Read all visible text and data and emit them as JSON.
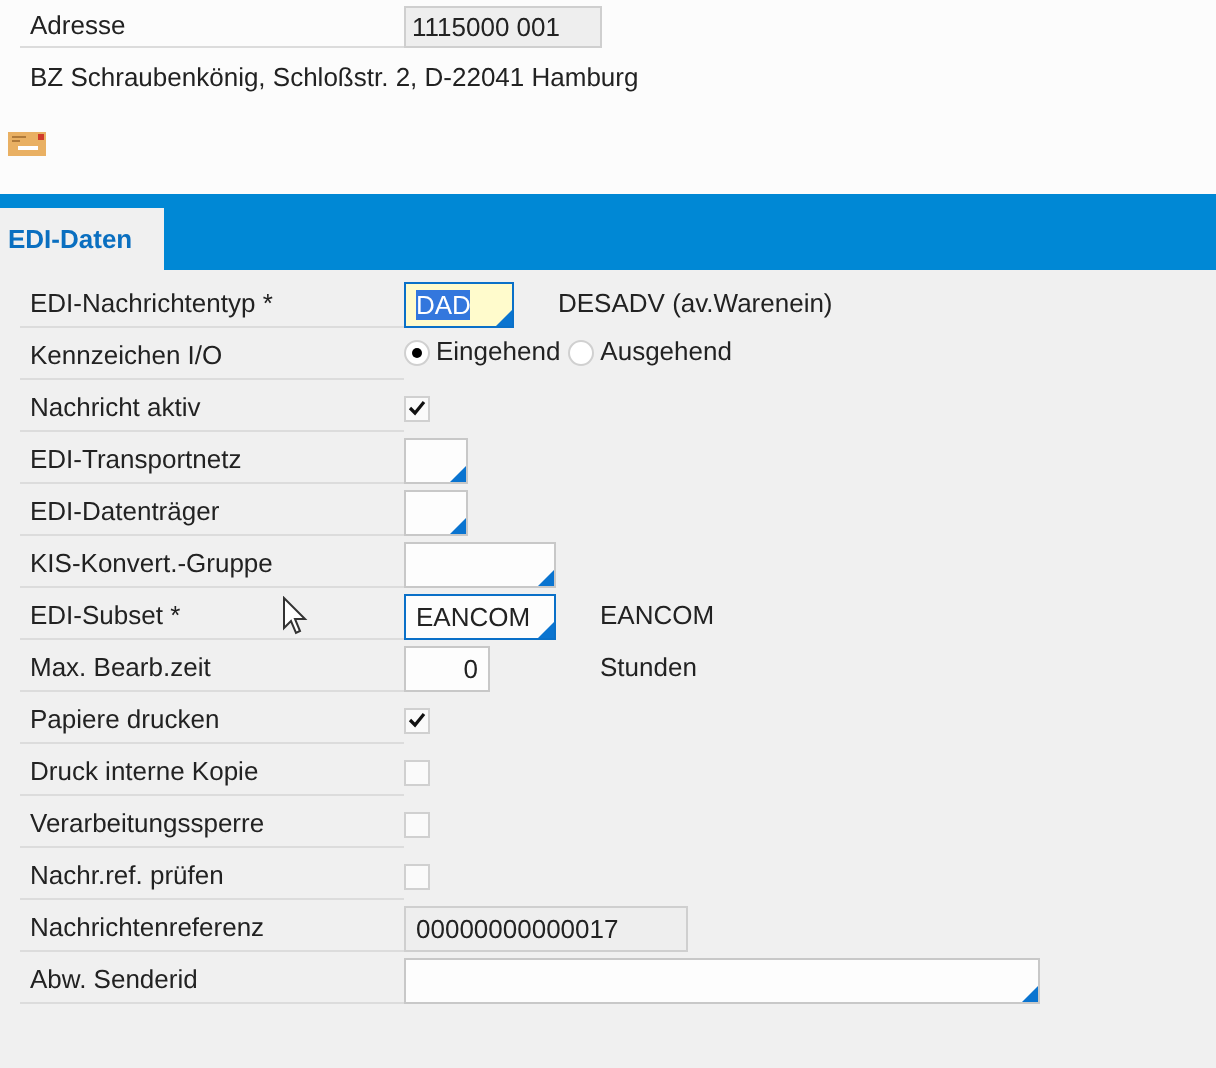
{
  "header": {
    "label": "Adresse",
    "value": "1115000 001",
    "address": "BZ Schraubenkönig, Schloßstr. 2, D-22041 Hamburg"
  },
  "tabs": [
    {
      "label": "EDI-Daten",
      "selected": true
    }
  ],
  "rows": [
    {
      "kind": "input",
      "label": "EDI-Nachrichtentyp *",
      "value": "DAD",
      "focused": true,
      "outlined": true,
      "value_help": true,
      "note": "DESADV (av.Warenein)"
    },
    {
      "kind": "radio",
      "label": "Kennzeichen I/O",
      "options": [
        {
          "label": "Eingehend",
          "selected": true
        },
        {
          "label": "Ausgehend",
          "selected": false
        }
      ]
    },
    {
      "kind": "checkbox",
      "label": "Nachricht aktiv",
      "checked": true
    },
    {
      "kind": "input",
      "label": "EDI-Transportnetz",
      "value_help": true
    },
    {
      "kind": "input",
      "label": "EDI-Datenträger",
      "value_help": true
    },
    {
      "kind": "input",
      "label": "KIS-Konvert.-Gruppe",
      "value_help": true
    },
    {
      "kind": "input",
      "label": "EDI-Subset *",
      "value": "EANCOM",
      "outlined": true,
      "value_help": true,
      "note": "EANCOM"
    },
    {
      "kind": "input",
      "label": "Max. Bearb.zeit",
      "value": "0",
      "note": "Stunden"
    },
    {
      "kind": "checkbox",
      "label": "Papiere drucken",
      "checked": true
    },
    {
      "kind": "checkbox",
      "label": "Druck interne Kopie",
      "checked": false
    },
    {
      "kind": "checkbox",
      "label": "Verarbeitungssperre",
      "checked": false
    },
    {
      "kind": "checkbox",
      "label": "Nachr.ref. prüfen",
      "checked": false
    },
    {
      "kind": "readonly",
      "label": "Nachrichtenreferenz",
      "value": "00000000000017"
    },
    {
      "kind": "input",
      "label": "Abw. Senderid",
      "value_help": true
    }
  ]
}
